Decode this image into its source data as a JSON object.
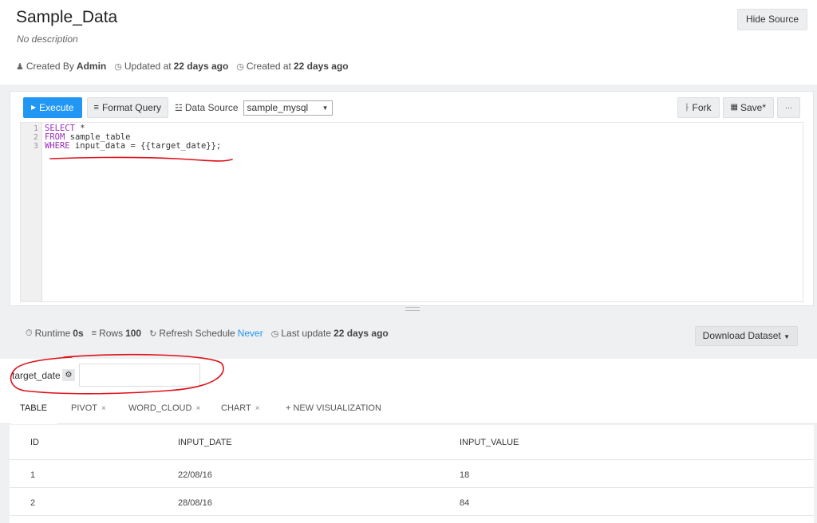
{
  "header": {
    "title": "Sample_Data",
    "description": "No description",
    "created_by_label": "Created By",
    "created_by_value": "Admin",
    "updated_label": "Updated at",
    "updated_value": "22 days ago",
    "created_label": "Created at",
    "created_value": "22 days ago",
    "hide_source_label": "Hide Source"
  },
  "toolbar": {
    "execute_label": "Execute",
    "format_label": "Format Query",
    "data_source_label": "Data Source",
    "data_source_value": "sample_mysql",
    "fork_label": "Fork",
    "save_label": "Save*",
    "more_label": "···"
  },
  "editor": {
    "line_numbers": [
      "1",
      "2",
      "3"
    ],
    "lines": [
      {
        "kw": "SELECT",
        "rest": " *"
      },
      {
        "kw": "FROM",
        "rest": " sample_table"
      },
      {
        "kw": "WHERE",
        "rest": " input_data = {{target_date}};"
      }
    ]
  },
  "stats": {
    "runtime_label": "Runtime",
    "runtime_value": "0s",
    "rows_label": "Rows",
    "rows_value": "100",
    "refresh_label": "Refresh Schedule",
    "refresh_value": "Never",
    "last_update_label": "Last update",
    "last_update_value": "22 days ago",
    "download_label": "Download Dataset"
  },
  "parameter": {
    "name": "target_date",
    "value": ""
  },
  "tabs": [
    {
      "label": "TABLE",
      "closable": false
    },
    {
      "label": "PIVOT",
      "closable": true
    },
    {
      "label": "WORD_CLOUD",
      "closable": true
    },
    {
      "label": "CHART",
      "closable": true
    },
    {
      "label": "+ NEW VISUALIZATION",
      "closable": false
    }
  ],
  "table": {
    "columns": [
      "ID",
      "INPUT_DATE",
      "INPUT_VALUE"
    ],
    "rows": [
      [
        "1",
        "22/08/16",
        "18"
      ],
      [
        "2",
        "28/08/16",
        "84"
      ]
    ]
  },
  "colors": {
    "accent": "#2196f3",
    "annotation": "#e0101a"
  }
}
